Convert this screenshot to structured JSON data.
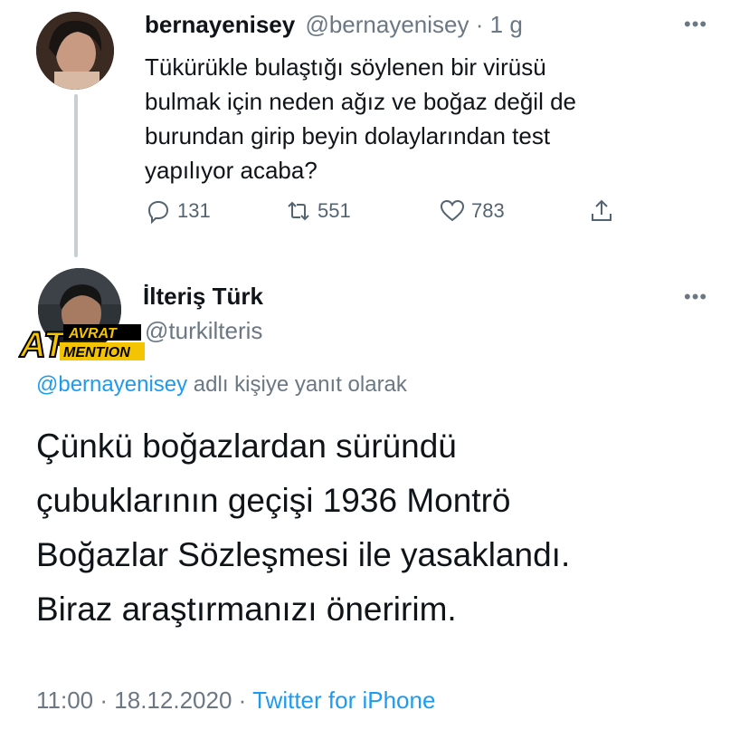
{
  "original_tweet": {
    "display_name": "bernayenisey",
    "handle": "@bernayenisey",
    "separator": "·",
    "time": "1 g",
    "lines": [
      "Tükürükle bulaştığı söylenen bir virüsü",
      "bulmak için neden ağız ve boğaz değil de",
      "burundan girip beyin dolaylarından test",
      "yapılıyor acaba?"
    ],
    "counts": {
      "replies": "131",
      "retweets": "551",
      "likes": "783"
    },
    "icons": {
      "reply": "reply-icon",
      "retweet": "retweet-icon",
      "like": "heart-icon",
      "share": "share-icon",
      "more": "more-icon"
    }
  },
  "reply_tweet": {
    "display_name": "İlteriş Türk",
    "handle": "@turkilteris",
    "badge": {
      "line1": "AT",
      "line2": "AVRAT",
      "line3": "MENTION"
    },
    "replying_to_user": "@bernayenisey",
    "replying_to_suffix": " adlı kişiye yanıt olarak",
    "lines": [
      "Çünkü boğazlardan süründü",
      "çubuklarının geçişi 1936 Montrö",
      "Boğazlar Sözleşmesi ile yasaklandı.",
      "Biraz araştırmanızı öneririm."
    ],
    "time": "11:00",
    "date": "18.12.2020",
    "sep": "·",
    "source": "Twitter for iPhone"
  },
  "more_label": "•••",
  "colors": {
    "link": "#1d9bf0",
    "muted": "#6b7884",
    "text": "#0f1419"
  }
}
